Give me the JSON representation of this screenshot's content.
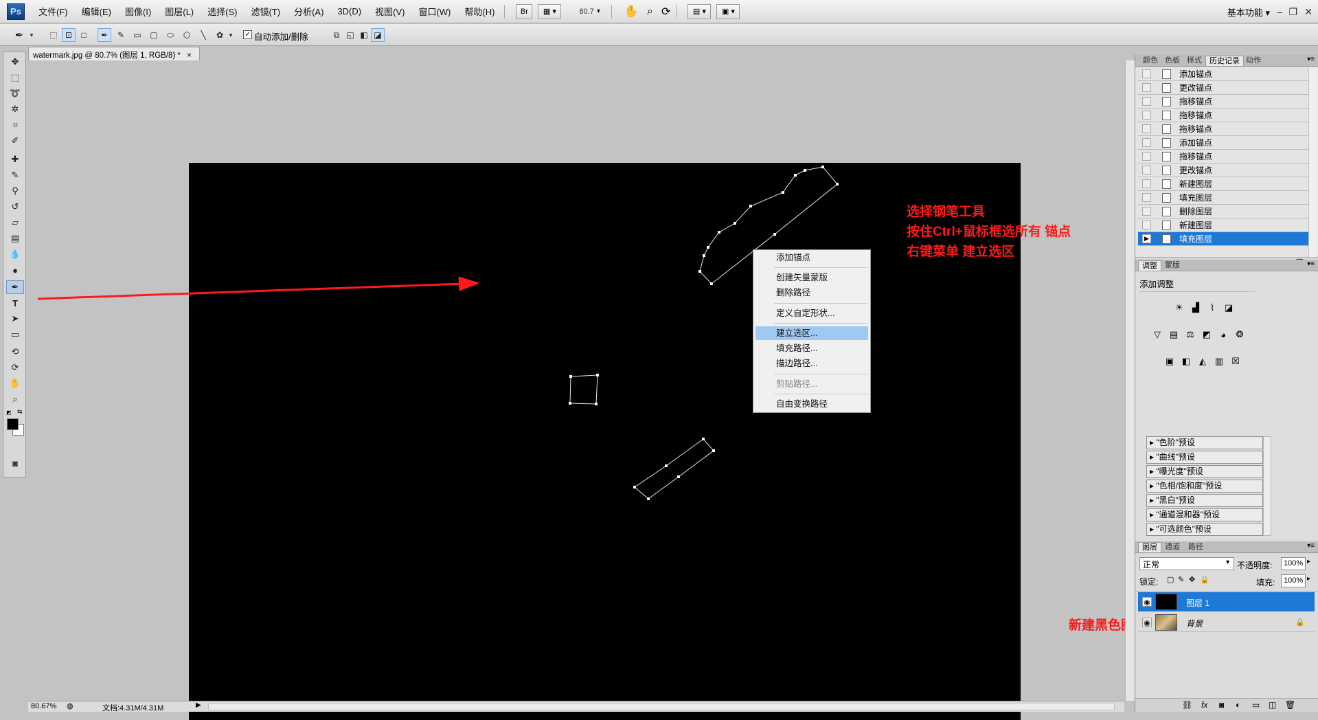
{
  "app": {
    "logo": "Ps",
    "workspace": "基本功能"
  },
  "menubar": {
    "items": [
      "文件(F)",
      "编辑(E)",
      "图像(I)",
      "图层(L)",
      "选择(S)",
      "滤镜(T)",
      "分析(A)",
      "3D(D)",
      "视图(V)",
      "窗口(W)",
      "帮助(H)"
    ],
    "br_label": "Br",
    "zoom": "80.7"
  },
  "options": {
    "auto_add_delete": "自动添加/删除"
  },
  "document": {
    "tab_title": "watermark.jpg @ 80.7% (图层 1, RGB/8) *",
    "close": "×"
  },
  "context_menu": {
    "items": [
      "添加锚点",
      "创建矢量蒙版",
      "删除路径",
      "定义自定形状...",
      "建立选区...",
      "填充路径...",
      "描边路径...",
      "剪贴路径...",
      "自由变换路径"
    ],
    "highlighted": "建立选区...",
    "disabled": "剪贴路径..."
  },
  "annotations": {
    "line1": "选择钢笔工具",
    "line2": "按住Ctrl+鼠标框选所有 锚点",
    "line3": "右键菜单 建立选区",
    "layer_note": "新建黑色图层",
    "color": "#ff1a1a"
  },
  "status": {
    "zoom": "80.67%",
    "doc_size": "文档:4.31M/4.31M"
  },
  "panels": {
    "top_tabs": [
      "颜色",
      "色板",
      "样式",
      "历史记录",
      "动作"
    ],
    "active_top_tab": "历史记录",
    "history": [
      "添加锚点",
      "更改锚点",
      "拖移锚点",
      "拖移锚点",
      "拖移锚点",
      "添加锚点",
      "拖移锚点",
      "更改锚点",
      "新建图层",
      "填充图层",
      "删除图层",
      "新建图层",
      "填充图层"
    ],
    "adj_tabs": [
      "调整",
      "蒙版"
    ],
    "adj_title": "添加调整",
    "presets": [
      "\"色阶\"预设",
      "\"曲线\"预设",
      "\"曝光度\"预设",
      "\"色相/饱和度\"预设",
      "\"黑白\"预设",
      "\"通道混和器\"预设",
      "\"可选颜色\"预设"
    ],
    "layer_tabs": [
      "图层",
      "通道",
      "路径"
    ],
    "blend_mode": "正常",
    "opacity_label": "不透明度:",
    "opacity": "100%",
    "lock_label": "锁定:",
    "fill_label": "填充:",
    "fill": "100%",
    "layers": [
      {
        "name": "图层 1",
        "selected": true
      },
      {
        "name": "背景",
        "selected": false
      }
    ]
  },
  "colors": {
    "accent": "#1e78d6",
    "highlight": "#9fc8f3",
    "canvas": "#000000"
  }
}
